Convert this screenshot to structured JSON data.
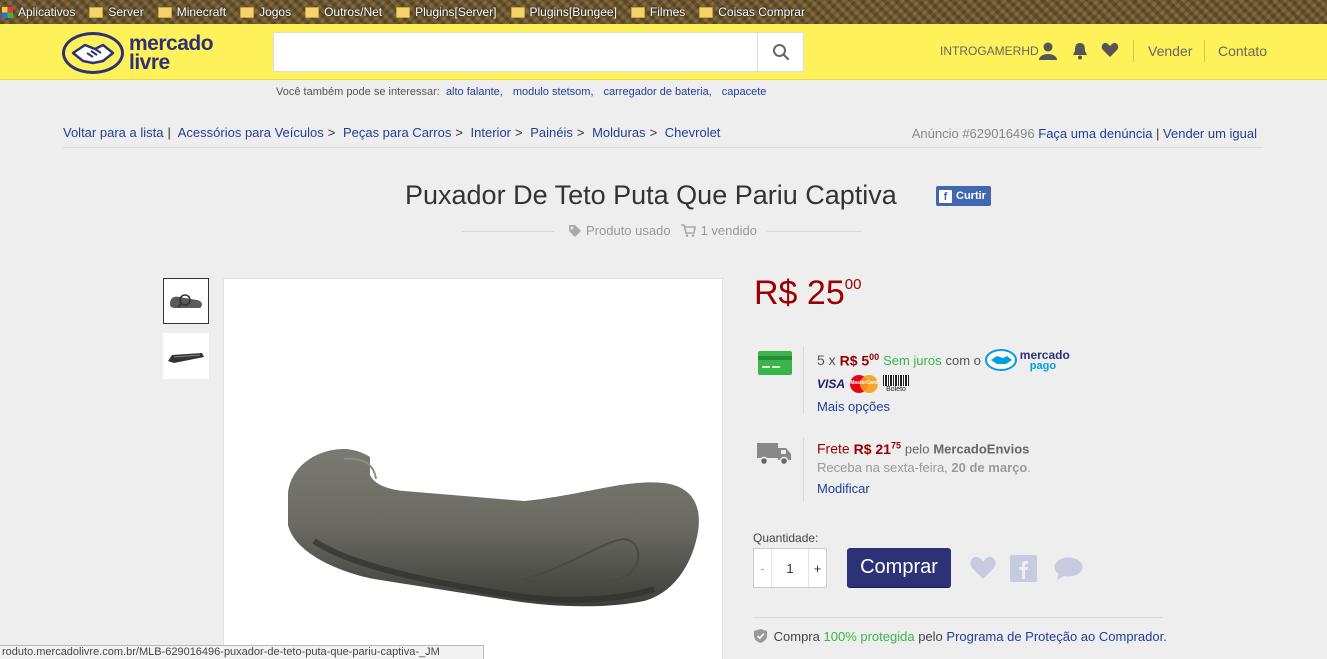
{
  "bookmarks": [
    "Aplicativos",
    "Server",
    "Minecraft",
    "Jogos",
    "Outros/Net",
    "Plugins[Server]",
    "Plugins[Bungee]",
    "Filmes",
    "Coisas Comprar"
  ],
  "header": {
    "logo_line1": "mercado",
    "logo_line2": "livre",
    "search_placeholder": "",
    "username": "INTROGAMERHD",
    "sell": "Vender",
    "contact": "Contato"
  },
  "suggest": {
    "label": "Você também pode se interessar:",
    "items": [
      "alto falante,",
      "modulo stetsom,",
      "carregador de bateria,",
      "capacete"
    ]
  },
  "breadcrumb": {
    "back": "Voltar para a lista",
    "path": [
      "Acessórios para Veículos",
      "Peças para Carros",
      "Interior",
      "Painéis",
      "Molduras",
      "Chevrolet"
    ],
    "ad_label": "Anúncio #629016496",
    "report": "Faça uma denúncia",
    "sell_same": "Vender um igual"
  },
  "product": {
    "title": "Puxador De Teto Puta Que Pariu Captiva",
    "like": "Curtir",
    "condition": "Produto usado",
    "sold": "1 vendido",
    "price_main": "R$ 25",
    "price_cents": "00"
  },
  "payment": {
    "installments": "5 x",
    "inst_amount": "R$ 5",
    "inst_cents": "00",
    "no_interest": "Sem juros",
    "with": "com o",
    "mp_line1": "mercado",
    "mp_line2": "pago",
    "visa": "VISA",
    "mastercard": "MasterCard",
    "boleto": "Boleto",
    "more": "Mais opções"
  },
  "shipping": {
    "label": "Frete",
    "amount": "R$ 21",
    "cents": "75",
    "by": "pelo",
    "carrier": "MercadoEnvios",
    "receive": "Receba na sexta-feira,",
    "date": "20 de março",
    "modify": "Modificar"
  },
  "purchase": {
    "qty_label": "Quantidade:",
    "qty": "1",
    "minus": "-",
    "plus": "+",
    "buy": "Comprar"
  },
  "protection": {
    "pre": "Compra",
    "pct": "100% protegida",
    "mid": "pelo",
    "program": "Programa de Proteção ao Comprador."
  },
  "status_url": "roduto.mercadolivre.com.br/MLB-629016496-puxador-de-teto-puta-que-pariu-captiva-_JM",
  "colors": {
    "header": "#fff159",
    "brand": "#2d3277",
    "price": "#990000",
    "link": "#1e3f9b",
    "green": "#39b54a"
  }
}
